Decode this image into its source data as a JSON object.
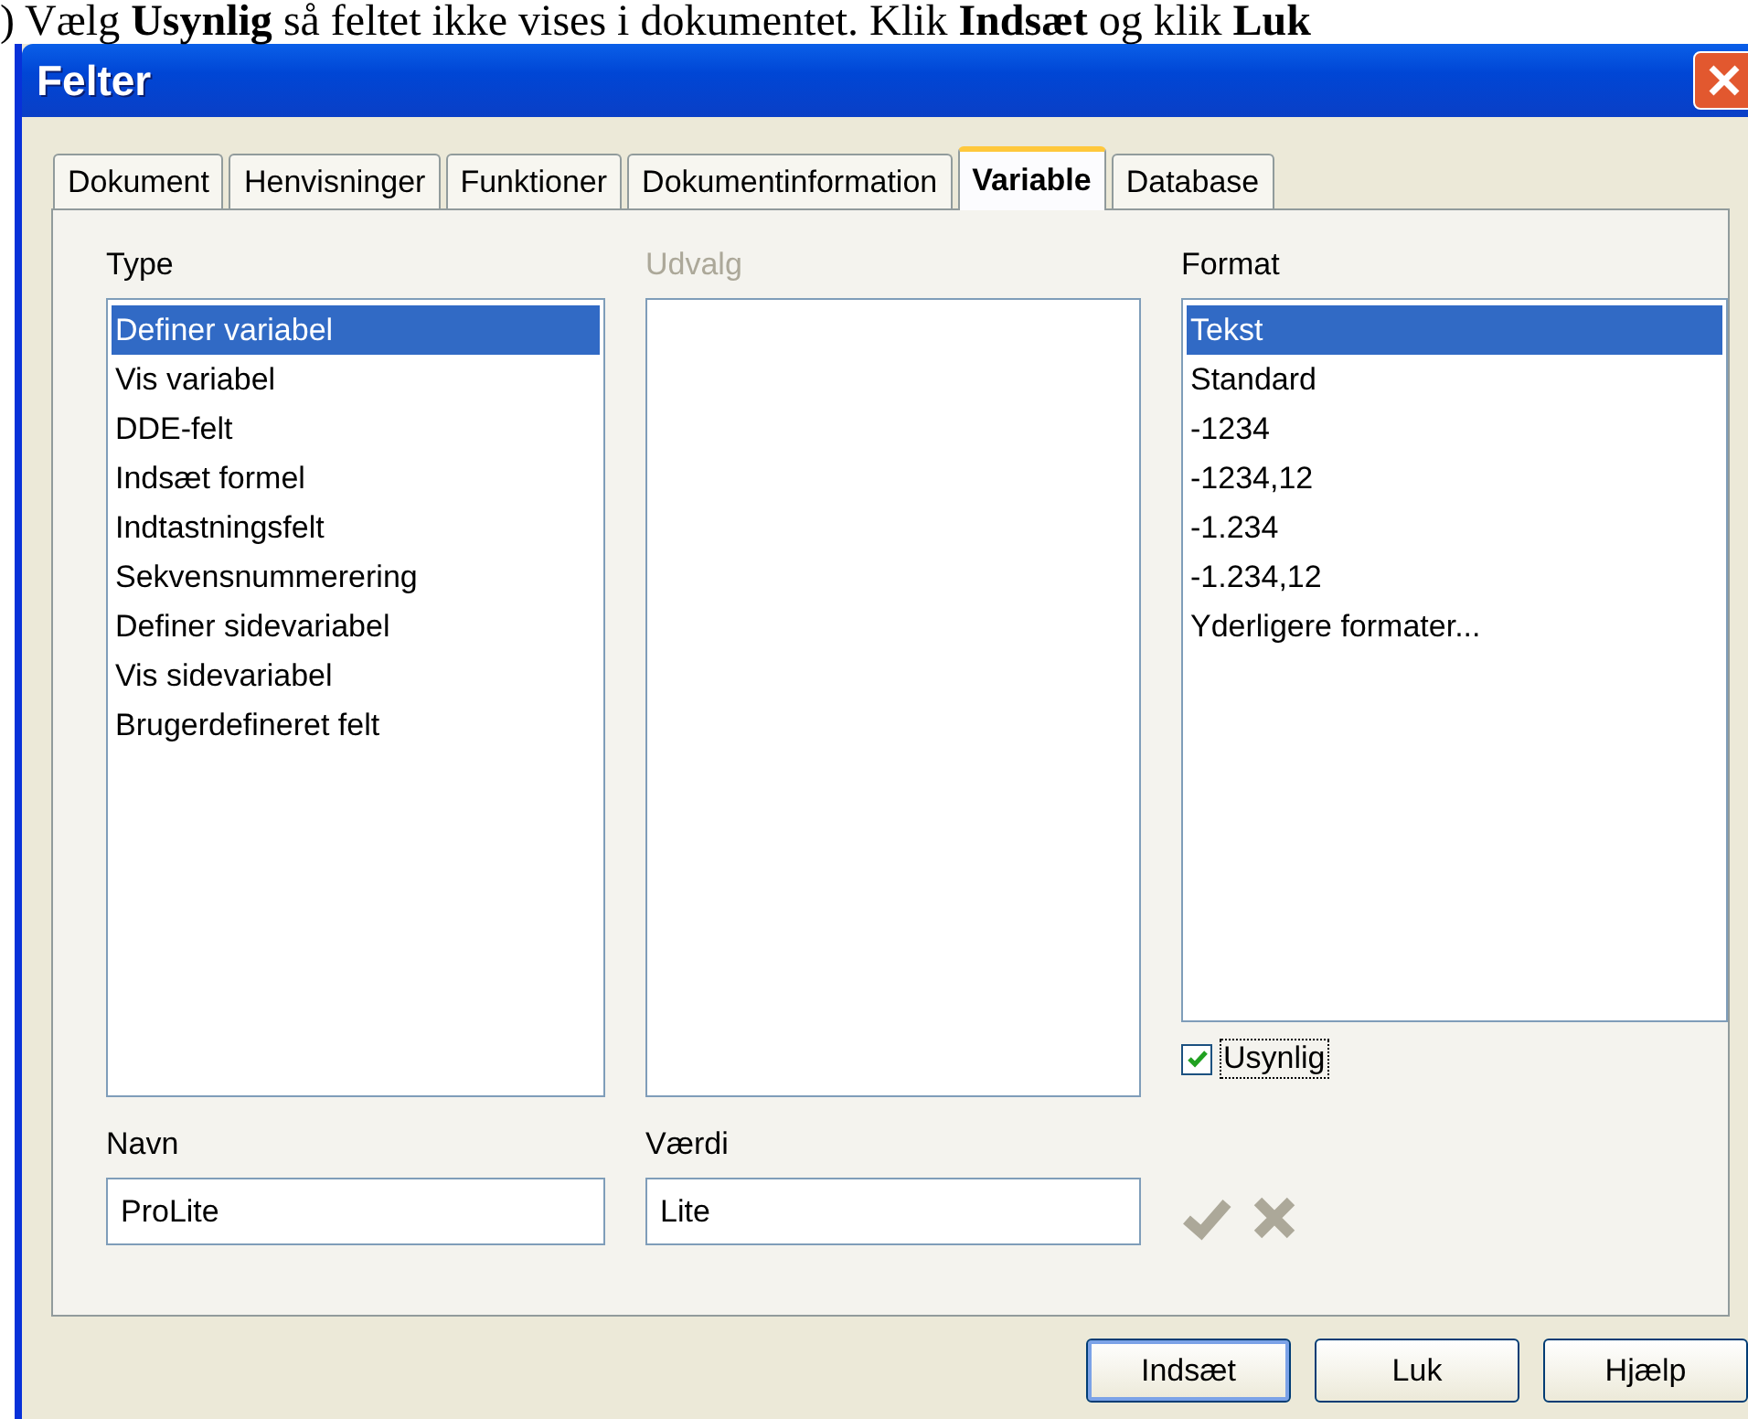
{
  "caption": ") Vælg **Usynlig** så feltet ikke vises i dokumentet. Klik **Indsæt** og klik **Luk**",
  "window": {
    "title": "Felter"
  },
  "tabs": [
    {
      "label": "Dokument",
      "selected": false
    },
    {
      "label": "Henvisninger",
      "selected": false
    },
    {
      "label": "Funktioner",
      "selected": false
    },
    {
      "label": "Dokumentinformation",
      "selected": false
    },
    {
      "label": "Variable",
      "selected": true
    },
    {
      "label": "Database",
      "selected": false
    }
  ],
  "type": {
    "label": "Type",
    "disabled": false,
    "items": [
      {
        "label": "Definer variabel",
        "selected": true
      },
      {
        "label": "Vis variabel",
        "selected": false
      },
      {
        "label": "DDE-felt",
        "selected": false
      },
      {
        "label": "Indsæt formel",
        "selected": false
      },
      {
        "label": "Indtastningsfelt",
        "selected": false
      },
      {
        "label": "Sekvensnummerering",
        "selected": false
      },
      {
        "label": "Definer sidevariabel",
        "selected": false
      },
      {
        "label": "Vis sidevariabel",
        "selected": false
      },
      {
        "label": "Brugerdefineret felt",
        "selected": false
      }
    ]
  },
  "selection": {
    "label": "Udvalg",
    "disabled": true
  },
  "format": {
    "label": "Format",
    "disabled": false,
    "items": [
      {
        "label": "Tekst",
        "selected": true
      },
      {
        "label": "Standard",
        "selected": false
      },
      {
        "label": "-1234",
        "selected": false
      },
      {
        "label": "-1234,12",
        "selected": false
      },
      {
        "label": "-1.234",
        "selected": false
      },
      {
        "label": "-1.234,12",
        "selected": false
      },
      {
        "label": "Yderligere formater...",
        "selected": false
      }
    ]
  },
  "invisible": {
    "label": "Usynlig",
    "checked": true
  },
  "name": {
    "label": "Navn",
    "value": "ProLite"
  },
  "value": {
    "label": "Værdi",
    "value": "Lite"
  },
  "buttons": [
    {
      "label": "Indsæt",
      "default": true
    },
    {
      "label": "Luk",
      "default": false
    },
    {
      "label": "Hjælp",
      "default": false
    }
  ]
}
